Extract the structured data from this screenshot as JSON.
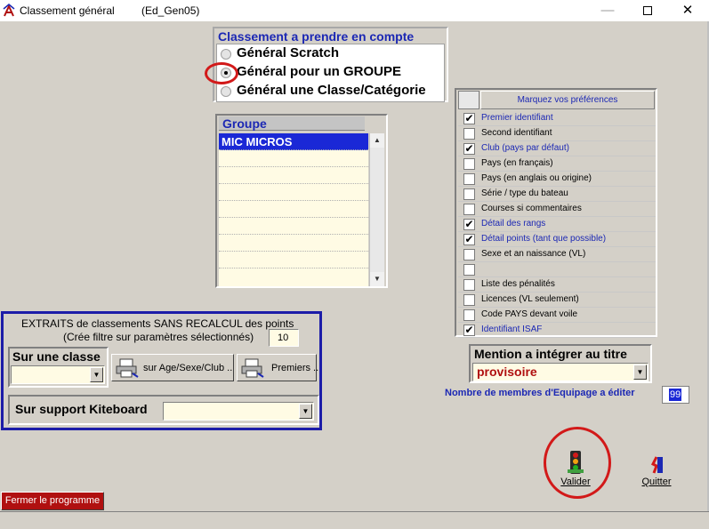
{
  "window": {
    "title": "Classement général",
    "file": "(Ed_Gen05)",
    "minimize": "—",
    "close": "✕"
  },
  "classement": {
    "header": "Classement a  prendre en compte",
    "options": [
      {
        "label": "Général Scratch",
        "selected": false
      },
      {
        "label": "Général pour un GROUPE",
        "selected": true
      },
      {
        "label": "Général une Classe/Catégorie",
        "selected": false
      }
    ]
  },
  "groupe": {
    "header": "Groupe",
    "rows": [
      "MIC MICROS",
      "",
      "",
      "",
      "",
      "",
      "",
      ""
    ]
  },
  "preferences": {
    "header": "Marquez vos préférences",
    "items": [
      {
        "label": "Premier identifiant",
        "checked": true
      },
      {
        "label": "Second identifiant",
        "checked": false
      },
      {
        "label": "Club (pays par défaut)",
        "checked": true
      },
      {
        "label": "Pays (en français)",
        "checked": false
      },
      {
        "label": "Pays (en anglais ou origine)",
        "checked": false
      },
      {
        "label": "Série / type du bateau",
        "checked": false
      },
      {
        "label": "Courses si commentaires",
        "checked": false
      },
      {
        "label": "Détail des rangs",
        "checked": true
      },
      {
        "label": "Détail points (tant que possible)",
        "checked": true
      },
      {
        "label": "Sexe et an naissance (VL)",
        "checked": false
      },
      {
        "label": "",
        "checked": false
      },
      {
        "label": "Liste des pénalités",
        "checked": false
      },
      {
        "label": "Licences (VL seulement)",
        "checked": false
      },
      {
        "label": "Code PAYS devant voile",
        "checked": false
      },
      {
        "label": "Identifiant ISAF",
        "checked": true
      }
    ]
  },
  "extraits": {
    "title": "EXTRAITS de classements SANS RECALCUL des points",
    "subtitle": "(Crée filtre sur paramètres sélectionnés)",
    "count": "10",
    "sur_classe_label": "Sur une classe",
    "age_button": "sur Age/Sexe/Club ..",
    "premiers_button": "Premiers ..",
    "kiteboard_label": "Sur support Kiteboard"
  },
  "mention": {
    "label": "Mention a intégrer au titre",
    "value": "provisoire"
  },
  "members": {
    "label": "Nombre de membres d'Equipage a éditer",
    "value": "99"
  },
  "actions": {
    "valider": "Valider",
    "quitter": "Quitter",
    "fermer": "Fermer le programme"
  },
  "colors": {
    "accent_blue": "#1c28b4",
    "selection": "#1a28d6",
    "alert_red": "#d21919",
    "list_bg": "#fffbe4",
    "panel_bg": "#d4d0c8"
  }
}
